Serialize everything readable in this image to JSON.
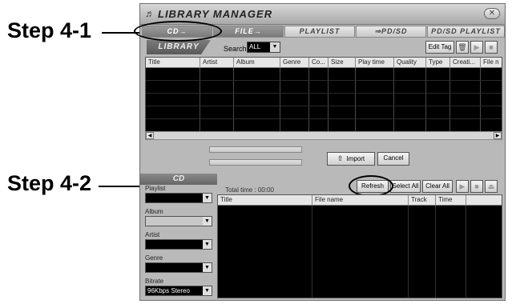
{
  "annotations": {
    "step1": "Step 4-1",
    "step2": "Step 4-2"
  },
  "window": {
    "title": "LIBRARY MANAGER",
    "close_symbol": "✕"
  },
  "tabs": [
    {
      "label": "CD→"
    },
    {
      "label": "FILE→"
    },
    {
      "label": "PLAYLIST"
    },
    {
      "label": "⇒PD/SD"
    },
    {
      "label": "PD/SD PLAYLIST"
    }
  ],
  "library": {
    "label": "LIBRARY",
    "search_label": "Search",
    "search_value": "ALL",
    "edit_tag": "Edit Tag",
    "columns": [
      "Title",
      "Artist",
      "Album",
      "Genre",
      "Co...",
      "Size",
      "Play time",
      "Quality",
      "Type",
      "Creati...",
      "File n"
    ]
  },
  "import_bar": {
    "import": "Import",
    "cancel": "Cancel"
  },
  "cd": {
    "label": "CD",
    "total_time": "Total time :  00:00",
    "refresh": "Refresh",
    "select_all": "Select All",
    "clear_all": "Clear All",
    "columns": [
      "Title",
      "File name",
      "Track",
      "Time"
    ],
    "fields": [
      {
        "label": "Playlist",
        "value": ""
      },
      {
        "label": "Album",
        "value": ""
      },
      {
        "label": "Artist",
        "value": ""
      },
      {
        "label": "Genre",
        "value": ""
      },
      {
        "label": "Bitrate",
        "value": "96Kbps Stereo"
      }
    ]
  }
}
